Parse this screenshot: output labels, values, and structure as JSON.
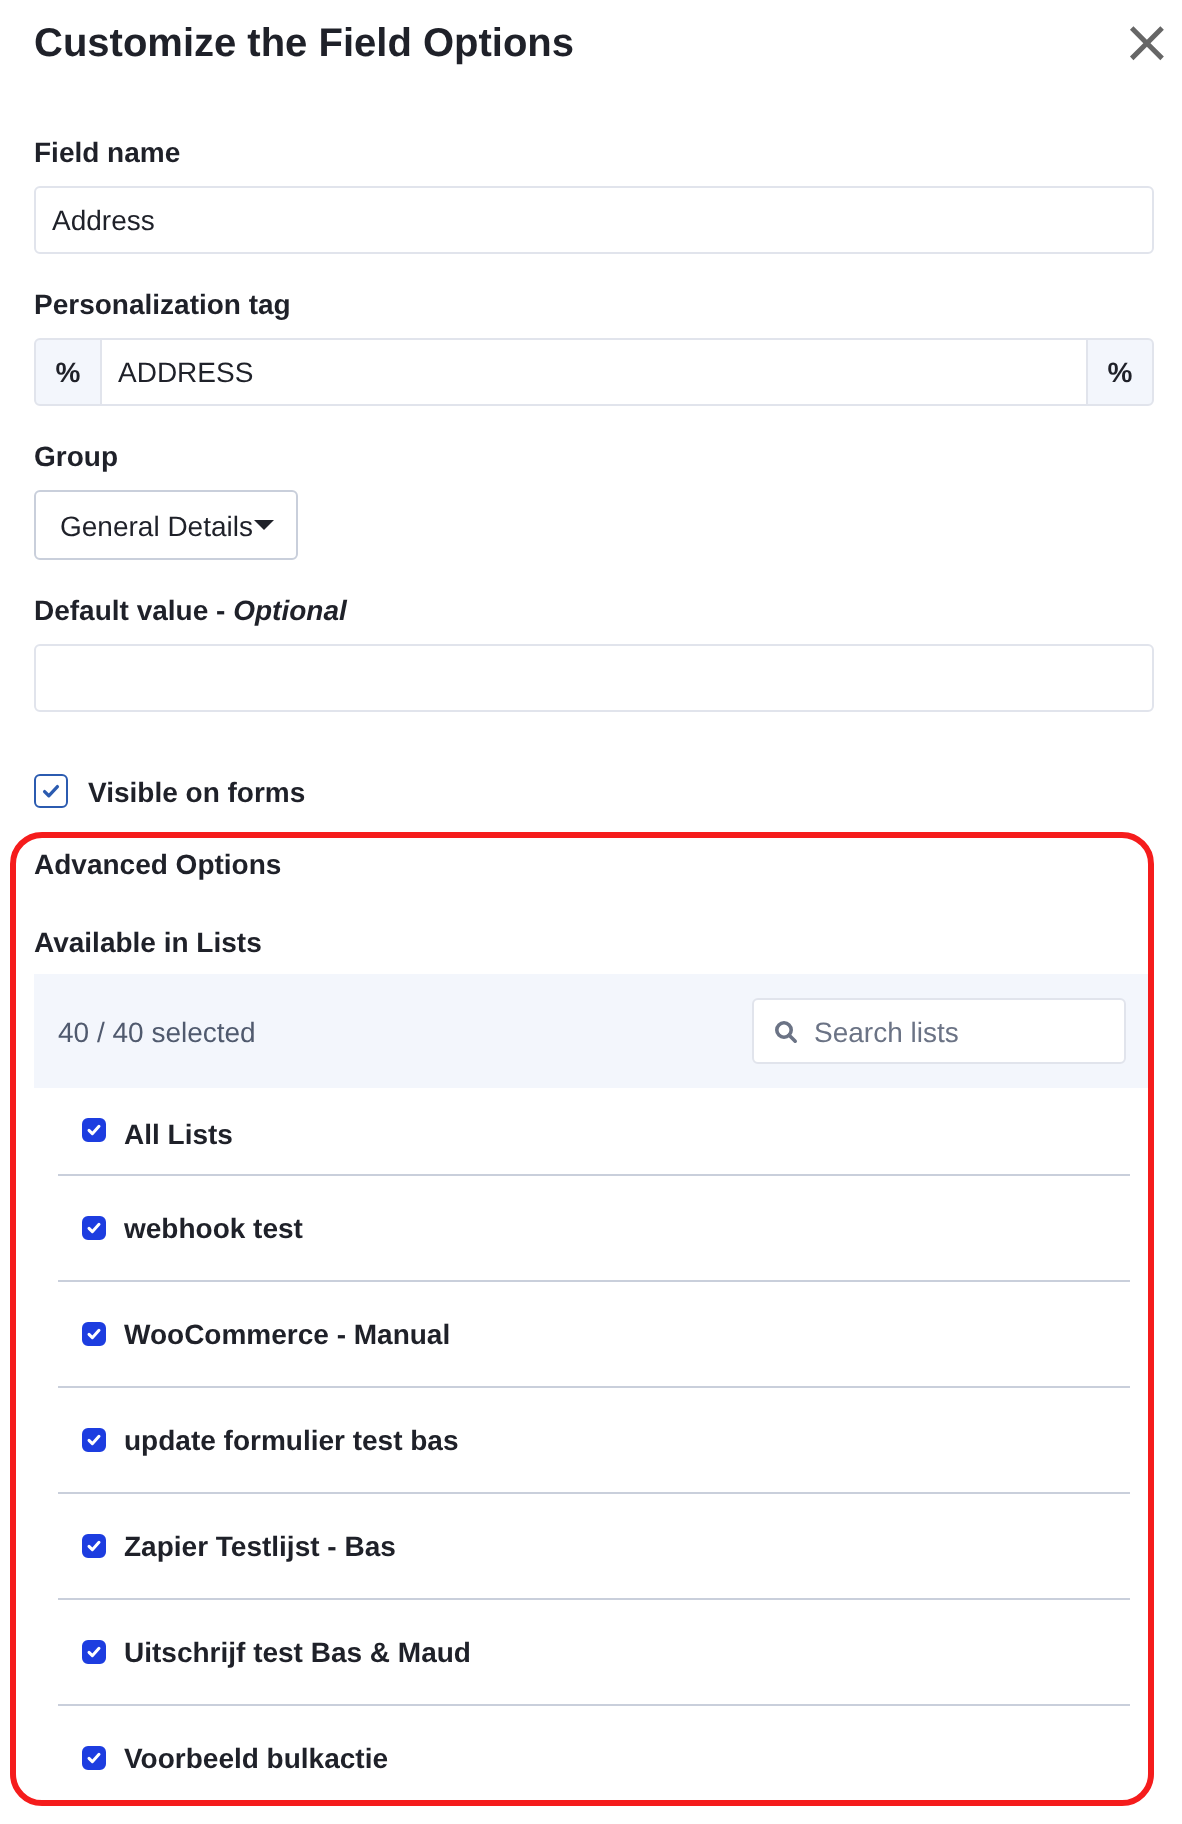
{
  "dialog": {
    "title": "Customize the Field Options",
    "close": "×"
  },
  "field_name": {
    "label": "Field name",
    "value": "Address"
  },
  "personalization_tag": {
    "label": "Personalization tag",
    "prefix": "%",
    "value": "ADDRESS",
    "suffix": "%"
  },
  "group": {
    "label": "Group",
    "value": "General Details"
  },
  "default_value": {
    "label": "Default value - *Optional*"
  },
  "visible_on_forms": {
    "label": "Visible on forms",
    "checked": true
  },
  "advanced": {
    "title": "Advanced Options",
    "subtitle": "Available in Lists",
    "count": "40 / 40 selected",
    "search": {
      "placeholder": "Search lists"
    },
    "lists": [
      {
        "name": "All Lists",
        "checked": true
      },
      {
        "name": "webhook test",
        "checked": true
      },
      {
        "name": "WooCommerce - Manual",
        "checked": true
      },
      {
        "name": "update formulier test bas",
        "checked": true
      },
      {
        "name": "Zapier Testlijst - Bas",
        "checked": true
      },
      {
        "name": "Uitschrijf test Bas & Maud",
        "checked": true
      },
      {
        "name": "Voorbeeld bulkactie",
        "checked": true
      }
    ]
  }
}
